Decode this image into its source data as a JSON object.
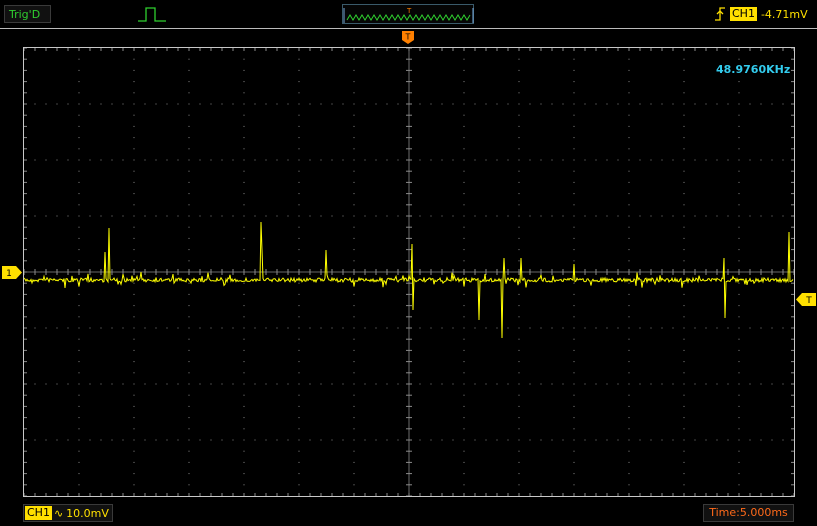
{
  "status": {
    "trigger_state": "Trig'D"
  },
  "trigger": {
    "channel": "CH1",
    "level": "-4.71mV",
    "position_marker": "T",
    "level_marker": "T"
  },
  "measurement": {
    "frequency": "48.9760KHz"
  },
  "channel1": {
    "marker": "1",
    "label": "CH1",
    "coupling_icon": "∿",
    "volts_per_div": "10.0mV"
  },
  "timebase": {
    "label": "Time:5.000ms"
  },
  "colors": {
    "trace": "#ffff00",
    "grid": "#8a8a8a",
    "status_text": "#2fcf2f",
    "frequency_text": "#33ccee",
    "timebase_text": "#ff6a1a",
    "trigger_marker": "#ff8000"
  },
  "chart_data": {
    "type": "line",
    "title": "",
    "xlabel": "",
    "ylabel": "",
    "divisions": {
      "x": 14,
      "y": 8
    },
    "grid": true,
    "description_free": true
  }
}
